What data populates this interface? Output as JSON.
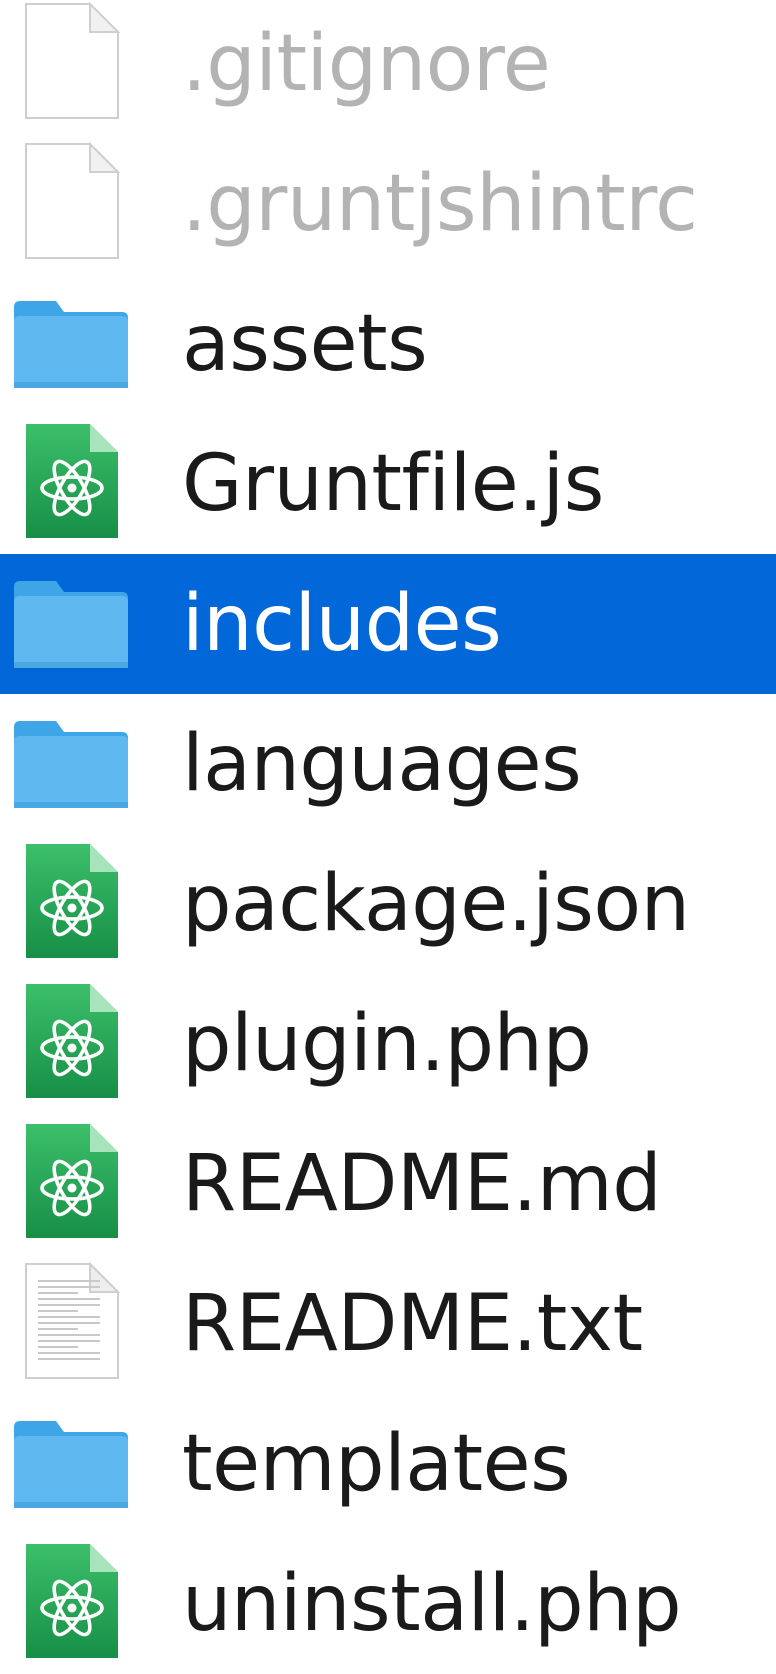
{
  "colors": {
    "selection": "#0268d9",
    "text": "#1a1a1a",
    "hidden_text": "#b3b3b3",
    "folder": "#5fb9f0",
    "atom_icon": "#24a055"
  },
  "files": [
    {
      "name": ".gitignore",
      "kind": "blank-file-icon",
      "hidden": true,
      "selected": false
    },
    {
      "name": ".gruntjshintrc",
      "kind": "blank-file-icon",
      "hidden": true,
      "selected": false
    },
    {
      "name": "assets",
      "kind": "folder-icon",
      "hidden": false,
      "selected": false
    },
    {
      "name": "Gruntfile.js",
      "kind": "atom-file-icon",
      "hidden": false,
      "selected": false
    },
    {
      "name": "includes",
      "kind": "folder-icon",
      "hidden": false,
      "selected": true
    },
    {
      "name": "languages",
      "kind": "folder-icon",
      "hidden": false,
      "selected": false
    },
    {
      "name": "package.json",
      "kind": "atom-file-icon",
      "hidden": false,
      "selected": false
    },
    {
      "name": "plugin.php",
      "kind": "atom-file-icon",
      "hidden": false,
      "selected": false
    },
    {
      "name": "README.md",
      "kind": "atom-file-icon",
      "hidden": false,
      "selected": false
    },
    {
      "name": "README.txt",
      "kind": "text-file-icon",
      "hidden": false,
      "selected": false
    },
    {
      "name": "templates",
      "kind": "folder-icon",
      "hidden": false,
      "selected": false
    },
    {
      "name": "uninstall.php",
      "kind": "atom-file-icon",
      "hidden": false,
      "selected": false
    }
  ]
}
